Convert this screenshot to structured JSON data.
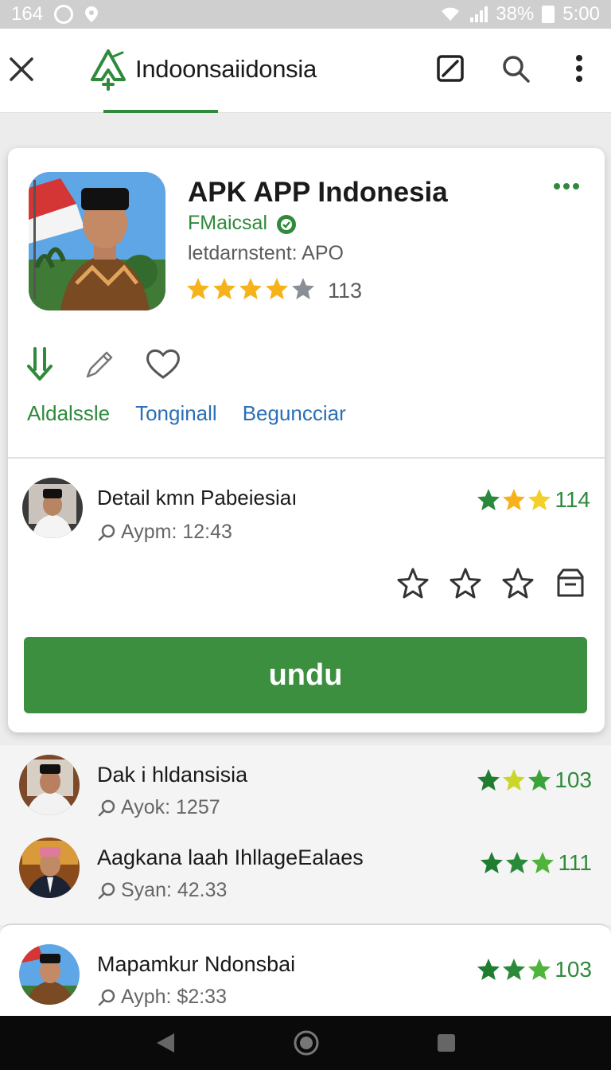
{
  "status_bar": {
    "left_text": "164",
    "battery": "38%",
    "time": "5:00",
    "icons": [
      "whatsapp-icon",
      "location-icon",
      "wifi-icon",
      "signal-icon",
      "battery-icon"
    ]
  },
  "app_bar": {
    "title": "Indoonsaiidonsia",
    "icons": [
      "close-icon",
      "logo-icon",
      "edit-icon",
      "search-icon",
      "more-vert-icon"
    ]
  },
  "app": {
    "name": "APK APP Indonesia",
    "developer": "FMaicsal",
    "meta": "letdarnstent: APO",
    "rating_count": "113",
    "rating": 4.5,
    "actions": [
      {
        "icon": "download-icon",
        "label": "Aldalssle"
      },
      {
        "icon": "edit-pencil-icon",
        "label": "Tonginall"
      },
      {
        "icon": "heart-icon",
        "label": "Beguncciar"
      }
    ]
  },
  "featured_review": {
    "title": "Detail kmn Pabeiesiaı",
    "meta": "Aypm: 12:43",
    "rating_count": "114"
  },
  "download_button": "undu",
  "list": [
    {
      "title": "Dak i hldansisia",
      "meta": "Ayok: 1257",
      "rating_count": "103"
    },
    {
      "title": "Aagkana laah IhllageEalaes",
      "meta": "Syan: 42.33",
      "rating_count": "111"
    },
    {
      "title": "Mapamkur Ndonsbai",
      "meta": "Ayph: $2:33",
      "rating_count": "103"
    }
  ],
  "colors": {
    "accent_green": "#2f8a3c",
    "button_green": "#3c8f3f",
    "link_blue": "#2b6fb6",
    "star_gold": "#f5b21a"
  }
}
